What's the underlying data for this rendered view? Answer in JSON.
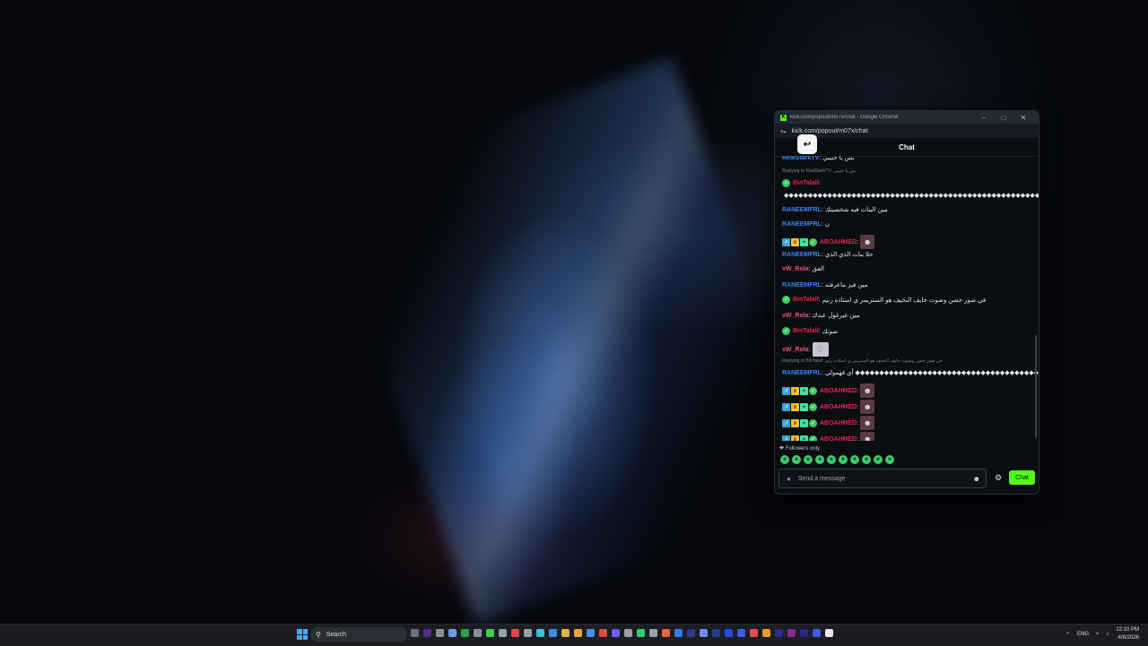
{
  "window": {
    "title": "kick.com/popout/m07x/chat - Google Chrome",
    "url": "kick.com/popout/m07x/chat",
    "favicon": "K"
  },
  "chat": {
    "header": "Chat",
    "messages": [
      {
        "user": "RealStarkTV",
        "text": "بس يا حبيبي",
        "color": "blue",
        "partial": true
      },
      {
        "reply": "Replying to RealStarkTV: بس يا حبيبي"
      },
      {
        "user": "BinTalall",
        "text": "",
        "color": "red",
        "badges": [
          "check"
        ]
      },
      {
        "text": "◆◆◆◆◆◆◆◆◆◆◆◆◆◆◆◆◆◆◆◆◆◆◆◆◆◆◆◆◆◆◆◆◆◆◆◆◆◆◆◆◆◆◆◆◆◆◆◆◆◆◆◆◆◆◆◆◆◆◆◆◆◆◆◆◆*"
      },
      {
        "user": "RANEEMFRL",
        "text": "مين البنات فيه شخصيتك",
        "color": "blue"
      },
      {
        "user": "RANEEMFRL",
        "text": "ن",
        "color": "blue"
      },
      {
        "user": "ABOAHMED",
        "text": "",
        "color": "red",
        "badges": [
          "b1",
          "b2",
          "b3",
          "check"
        ],
        "emote": true
      },
      {
        "user": "RANEEMFRL",
        "text": "حلا بنات الذي الذي",
        "color": "blue"
      },
      {
        "user": "vW_Rola",
        "text": "الفق",
        "color": "pink"
      },
      {
        "user": "RANEEMFRL",
        "text": "مين فيز ماعرفته",
        "color": "blue"
      },
      {
        "user": "BinTalall",
        "text": "في صور خشن وصوت خايف النخيف هو الستريمر ي استاذه زنيم",
        "color": "red",
        "badges": [
          "check"
        ]
      },
      {
        "user": "vW_Rola",
        "text": "مين غيرغول عندك",
        "color": "pink"
      },
      {
        "user": "BinTalall",
        "text": "صوتك",
        "color": "red",
        "badges": [
          "check"
        ]
      },
      {
        "user": "vW_Rola",
        "text": "",
        "color": "pink",
        "emote2": true
      },
      {
        "reply": "Replying to BinTalall: في صور خشن وصوت خايف النخيف هو الستريمر ي استاذه زنيم"
      },
      {
        "user": "RANEEMFRL",
        "text": "آي فهمولي ◆◆◆◆◆◆◆◆◆◆◆◆◆◆◆◆◆◆◆◆◆◆◆◆◆◆◆◆◆◆◆◆◆◆◆◆◆◆◆◆*",
        "color": "blue"
      },
      {
        "user": "ABOAHMED",
        "text": "",
        "color": "red",
        "badges": [
          "b1",
          "b2",
          "b3",
          "check"
        ],
        "emote": true
      },
      {
        "user": "ABOAHMED",
        "text": "",
        "color": "red",
        "badges": [
          "b1",
          "b2",
          "b3",
          "check"
        ],
        "emote": true
      },
      {
        "user": "ABOAHMED",
        "text": "",
        "color": "red",
        "badges": [
          "b1",
          "b2",
          "b3",
          "check"
        ],
        "emote": true
      },
      {
        "user": "ABOAHMED",
        "text": "",
        "color": "red",
        "badges": [
          "b1",
          "b2",
          "b3",
          "check"
        ],
        "emote": true
      }
    ],
    "followers_only": "Followers only",
    "input_placeholder": "Send a message",
    "send_label": "Chat",
    "accent": "#53fc18"
  },
  "taskbar": {
    "search_label": "Search",
    "lang": "ENG",
    "time": "12:10 PM",
    "date": "4/6/2026"
  }
}
